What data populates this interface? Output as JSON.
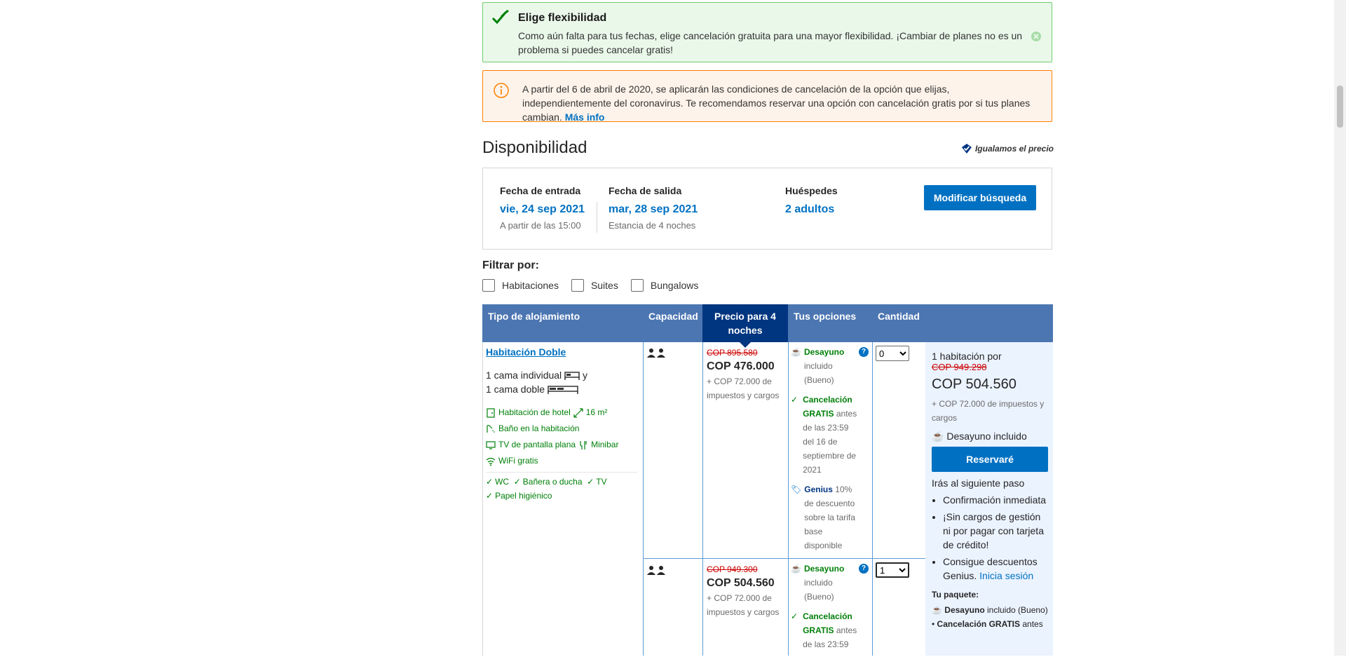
{
  "notice_flex": {
    "title": "Elige flexibilidad",
    "text": "Como aún falta para tus fechas, elige cancelación gratuita para una mayor flexibilidad. ¡Cambiar de planes no es un problema si puedes cancelar gratis!"
  },
  "notice_covid": {
    "text": "A partir del 6 de abril de 2020, se aplicarán las condiciones de cancelación de la opción que elijas, independientemente del coronavirus. Te recomendamos reservar una opción con cancelación gratis por si tus planes cambian.",
    "more_link": "Más info"
  },
  "availability": {
    "title": "Disponibilidad",
    "price_match": "Igualamos el precio"
  },
  "search": {
    "checkin_label": "Fecha de entrada",
    "checkin_value": "vie, 24 sep 2021",
    "checkin_sub": "A partir de las 15:00",
    "checkout_label": "Fecha de salida",
    "checkout_value": "mar, 28 sep 2021",
    "checkout_sub": "Estancia de 4 noches",
    "guests_label": "Huéspedes",
    "guests_value": "2 adultos",
    "modify_button": "Modificar búsqueda"
  },
  "filter": {
    "label": "Filtrar por:",
    "options": [
      "Habitaciones",
      "Suites",
      "Bungalows"
    ]
  },
  "table": {
    "headers": {
      "room_type": "Tipo de alojamiento",
      "capacity": "Capacidad",
      "price": "Precio para 4 noches",
      "options": "Tus opciones",
      "quantity": "Cantidad"
    },
    "room": {
      "name": "Habitación Doble",
      "bed1": "1 cama individual",
      "bed_join": "y",
      "bed2": "1 cama doble",
      "facilities": {
        "hotel_room": "Habitación de hotel",
        "size": "16 m²",
        "bathroom": "Baño en la habitación",
        "tv": "TV de pantalla plana",
        "minibar": "Minibar",
        "wifi": "WiFi gratis"
      },
      "amenities": [
        "WC",
        "Bañera o ducha",
        "TV",
        "Papel higiénico"
      ]
    },
    "rows": [
      {
        "old_price": "COP 895.580",
        "price": "COP 476.000",
        "taxes": "+ COP 72.000 de impuestos y cargos",
        "breakfast_bold": "Desayuno",
        "breakfast_rest": "incluido (Bueno)",
        "cancel_bold": "Cancelación GRATIS",
        "cancel_rest": "antes de las 23:59 del 16 de septiembre de 2021",
        "genius_bold": "Genius",
        "genius_rest": "10% de descuento sobre la tarifa base disponible",
        "qty": "0"
      },
      {
        "old_price": "COP 949.300",
        "price": "COP 504.560",
        "taxes": "+ COP 72.000 de impuestos y cargos",
        "breakfast_bold": "Desayuno",
        "breakfast_rest": "incluido (Bueno)",
        "cancel_bold": "Cancelación GRATIS",
        "cancel_rest": "antes de las 23:59",
        "qty": "1"
      }
    ]
  },
  "reserve": {
    "count_text": "1 habitación por",
    "old_price": "COP 949.298",
    "price": "COP 504.560",
    "taxes": "+ COP 72.000 de impuestos y cargos",
    "breakfast": "Desayuno incluido",
    "button": "Reservaré",
    "next_step": "Irás al siguiente paso",
    "bullets": [
      "Confirmación inmediata",
      "¡Sin cargos de gestión ni por pagar con tarjeta de crédito!"
    ],
    "genius_bullet": "Consigue descuentos Genius.",
    "genius_link": "Inicia sesión",
    "package_title": "Tu paquete:",
    "package_breakfast_bold": "Desayuno",
    "package_breakfast_rest": "incluido (Bueno)",
    "package_cancel_bold": "Cancelación GRATIS",
    "package_cancel_rest": "antes"
  },
  "colors": {
    "brand_blue": "#0071c2",
    "header_blue": "#4c76b2",
    "selected_header": "#003580",
    "green": "#008009",
    "price_old": "#cc0000"
  }
}
